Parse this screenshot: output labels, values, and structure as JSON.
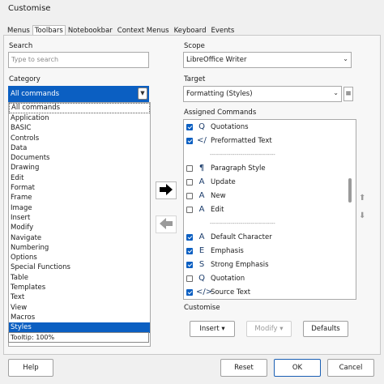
{
  "window": {
    "title": "Customise"
  },
  "tabs": [
    "Menus",
    "Toolbars",
    "Notebookbar",
    "Context Menus",
    "Keyboard",
    "Events"
  ],
  "search": {
    "label": "Search",
    "placeholder": "Type to search"
  },
  "category": {
    "label": "Category",
    "selected": "All commands",
    "items": [
      "All commands",
      "Application",
      "BASIC",
      "Controls",
      "Data",
      "Documents",
      "Drawing",
      "Edit",
      "Format",
      "Frame",
      "Image",
      "Insert",
      "Modify",
      "Navigate",
      "Numbering",
      "Options",
      "Special Functions",
      "Table",
      "Templates",
      "Text",
      "View",
      "Macros",
      "Styles"
    ],
    "highlighted": "Styles",
    "tooltip": "Tooltip: 100%"
  },
  "scope": {
    "label": "Scope",
    "value": "LibreOffice Writer"
  },
  "target": {
    "label": "Target",
    "value": "Formatting (Styles)"
  },
  "assigned": {
    "label": "Assigned Commands",
    "items": [
      {
        "label": "Quotations",
        "checked": true,
        "icon": "Q"
      },
      {
        "label": "Preformatted Text",
        "checked": true,
        "icon": "</"
      },
      {
        "separator": true,
        "label": "--------------------------------"
      },
      {
        "label": "Paragraph Style",
        "checked": false,
        "icon": "¶"
      },
      {
        "label": "Update",
        "checked": false,
        "icon": "A"
      },
      {
        "label": "New",
        "checked": false,
        "icon": "A"
      },
      {
        "label": "Edit",
        "checked": false,
        "icon": "A"
      },
      {
        "separator": true,
        "label": "--------------------------------"
      },
      {
        "label": "Default Character",
        "checked": true,
        "icon": "A"
      },
      {
        "label": "Emphasis",
        "checked": true,
        "icon": "E"
      },
      {
        "label": "Strong Emphasis",
        "checked": true,
        "icon": "S"
      },
      {
        "label": "Quotation",
        "checked": false,
        "icon": "Q"
      },
      {
        "label": "Source Text",
        "checked": true,
        "icon": "</>"
      }
    ]
  },
  "customise": {
    "label": "Customise",
    "insert": "Insert",
    "modify": "Modify",
    "defaults": "Defaults"
  },
  "footer": {
    "help": "Help",
    "reset": "Reset",
    "ok": "OK",
    "cancel": "Cancel"
  },
  "colors": {
    "accent": "#0b5fc2"
  }
}
